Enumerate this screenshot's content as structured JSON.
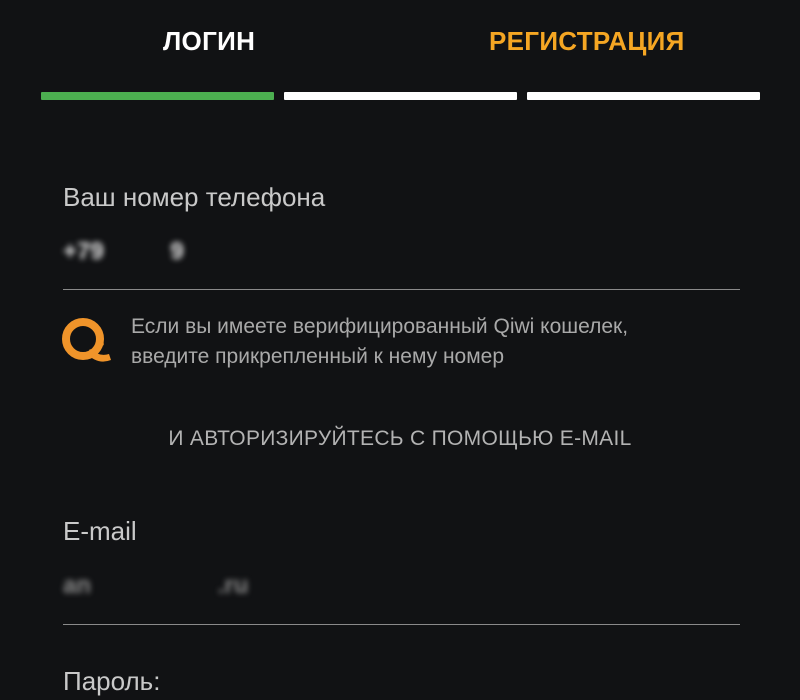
{
  "tabs": {
    "login": "ЛОГИН",
    "register": "РЕГИСТРАЦИЯ",
    "login_color": "#ffffff",
    "register_color": "#f5a623"
  },
  "progress": {
    "steps_total": 3,
    "steps_completed": 1,
    "active_color": "#4caf50",
    "inactive_color": "#ffffff"
  },
  "phone": {
    "label": "Ваш номер телефона",
    "value": "+79          9"
  },
  "qiwi_hint": {
    "icon": "qiwi-logo-icon",
    "icon_color": "#f0942a",
    "line1": "Если вы имеете верифицированный Qiwi кошелек,",
    "line2": "введите прикрепленный к нему номер"
  },
  "auth_email_text": "И АВТОРИЗИРУЙТЕСЬ С ПОМОЩЬЮ E-MAIL",
  "email": {
    "label": "E-mail",
    "value": "an                   .ru"
  },
  "password": {
    "label": "Пароль:"
  }
}
